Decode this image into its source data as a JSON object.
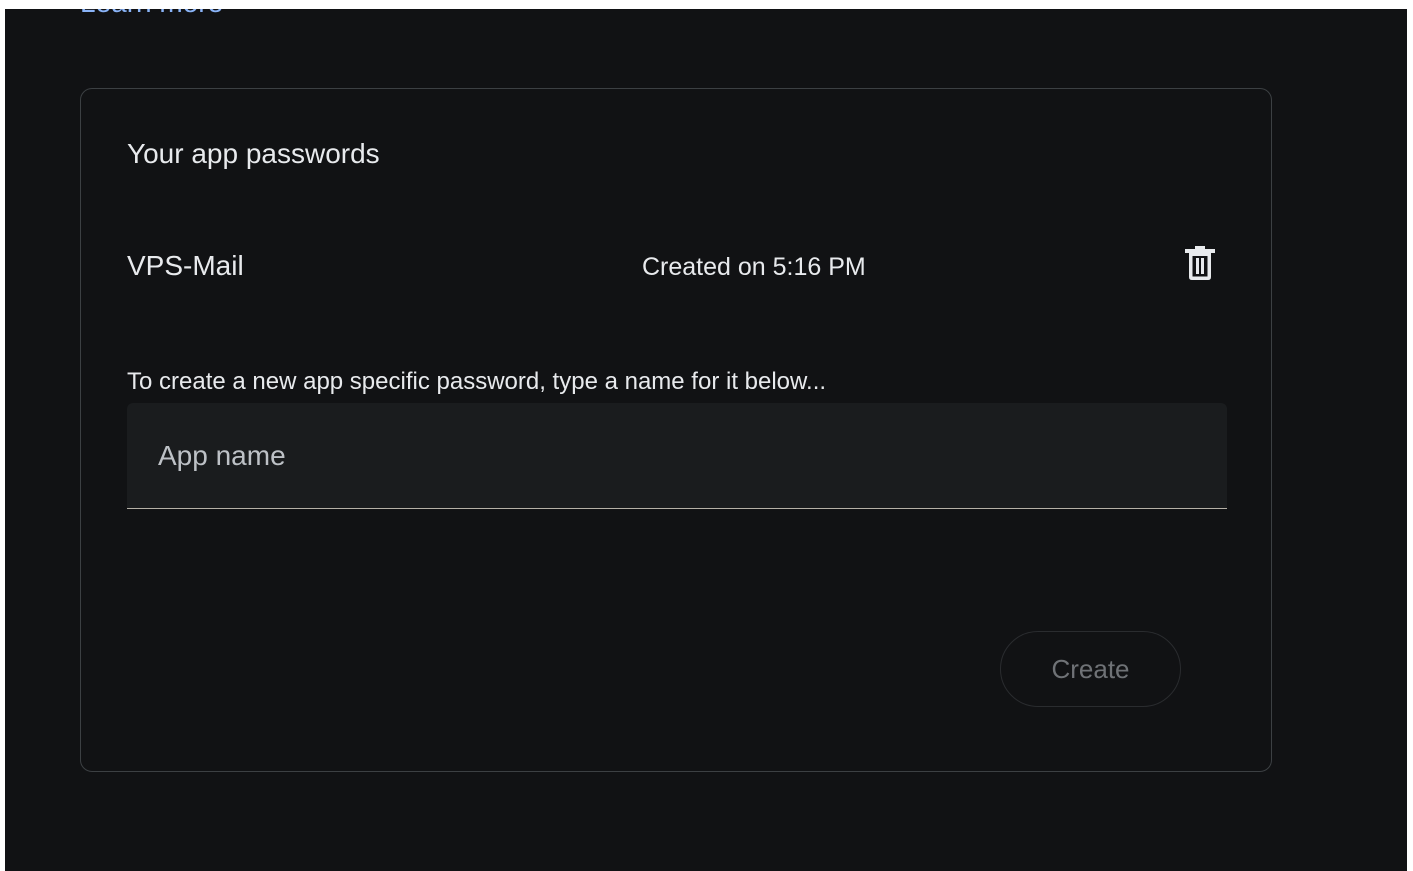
{
  "header": {
    "learn_more": "Learn more"
  },
  "card": {
    "title": "Your app passwords",
    "passwords": [
      {
        "name": "VPS-Mail",
        "created": "Created on 5:16 PM"
      }
    ],
    "hint": "To create a new app specific password, type a name for it below...",
    "app_name_placeholder": "App name",
    "create_label": "Create"
  },
  "icons": {
    "delete": "trash-icon"
  },
  "colors": {
    "background": "#111214",
    "text": "#e8eaed",
    "link": "#8ab4f8",
    "card_border": "#3c4043",
    "field_bg": "#1a1c1e",
    "disabled_text": "#6f7276"
  }
}
